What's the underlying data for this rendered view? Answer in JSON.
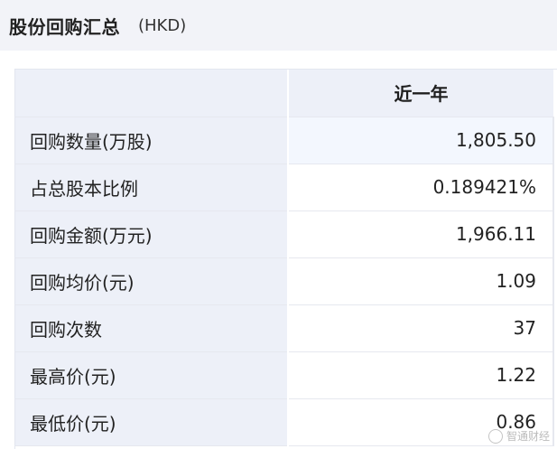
{
  "header": {
    "title": "股份回购汇总",
    "currency": "(HKD)"
  },
  "table": {
    "column_header": "近一年",
    "rows": [
      {
        "label": "回购数量(万股)",
        "value": "1,805.50"
      },
      {
        "label": "占总股本比例",
        "value": "0.189421%"
      },
      {
        "label": "回购金额(万元)",
        "value": "1,966.11"
      },
      {
        "label": "回购均价(元)",
        "value": "1.09"
      },
      {
        "label": "回购次数",
        "value": "37"
      },
      {
        "label": "最高价(元)",
        "value": "1.22"
      },
      {
        "label": "最低价(元)",
        "value": "0.86"
      }
    ]
  },
  "watermark": {
    "text": "智通财经"
  },
  "colors": {
    "header_bg": "#f2f3f8",
    "label_bg": "#edf0f8",
    "highlight_bg": "#f3f7fe",
    "border": "#e6e8ef"
  }
}
